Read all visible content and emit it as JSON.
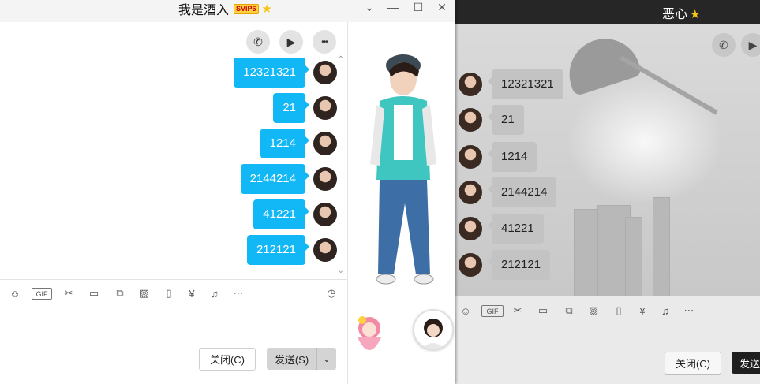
{
  "main_window": {
    "title": "我是酒入",
    "vip_badge": "SVIP6",
    "title_star": "★",
    "controls": {
      "minimize": "—",
      "maximize": "☐",
      "close": "✕",
      "dropdown": "⌄"
    },
    "top_buttons": {
      "call": "✆",
      "video": "▶",
      "more": "•••"
    },
    "messages": [
      "12321321",
      "21",
      "1214",
      "2144214",
      "41221",
      "212121"
    ],
    "scroll_up": "⌃",
    "scroll_down": "⌄",
    "toolbar": {
      "emoji": "☺",
      "gif": "GIF",
      "cut": "✂",
      "folder": "▭",
      "doc": "⧉",
      "image": "▨",
      "phone_shake": "▯",
      "red_packet": "¥",
      "music": "♫",
      "more": "⋯",
      "history": "◷"
    },
    "close_button": "关闭(C)",
    "send_button": "发送(S)",
    "send_dropdown": "⌄"
  },
  "bg_window": {
    "title": "恶心",
    "title_star": "★",
    "top_buttons": {
      "call": "✆",
      "video": "▶"
    },
    "messages": [
      "12321321",
      "21",
      "1214",
      "2144214",
      "41221",
      "212121"
    ],
    "toolbar": {
      "emoji": "☺",
      "gif": "GIF",
      "cut": "✂",
      "folder": "▭",
      "doc": "⧉",
      "image": "▨",
      "phone_shake": "▯",
      "red_packet": "¥",
      "music": "♫",
      "more": "⋯"
    },
    "close_button": "关闭(C)",
    "send_button": "发送"
  },
  "colors": {
    "bubble_blue": "#12b7f5",
    "bg_bubble_gray": "#c3c3c3",
    "titlebar_dark": "#262626"
  }
}
